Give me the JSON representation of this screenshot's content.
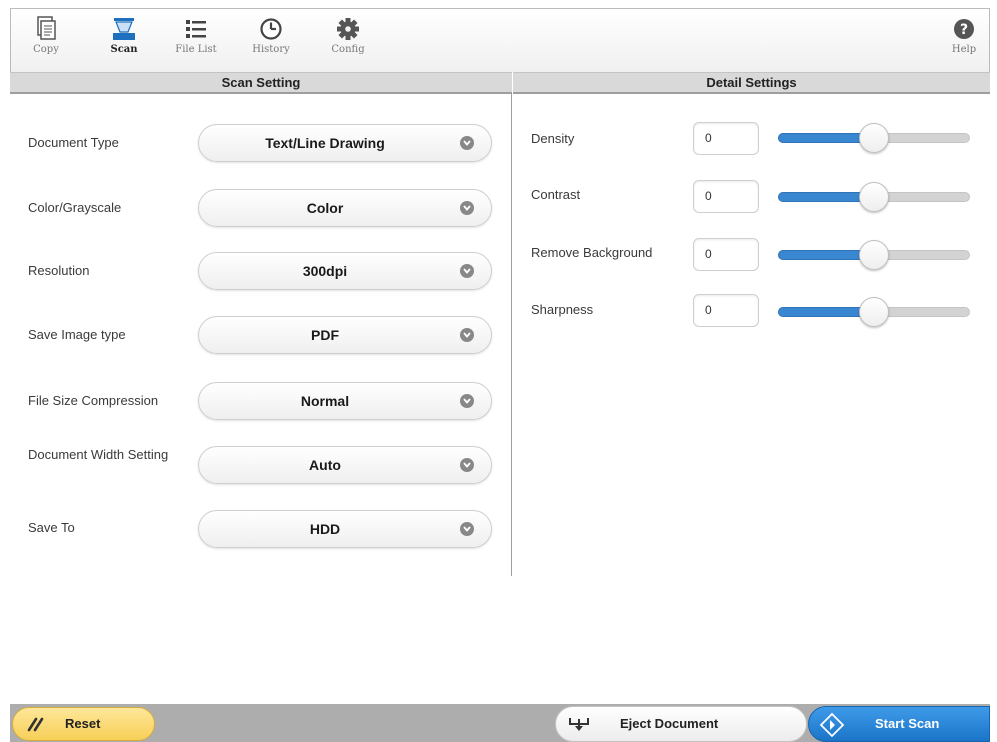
{
  "toolbar": {
    "copy": {
      "label": "Copy",
      "icon": "copy-icon"
    },
    "scan": {
      "label": "Scan",
      "icon": "scan-icon",
      "active": true
    },
    "file_list": {
      "label": "File List",
      "icon": "list-icon"
    },
    "history": {
      "label": "History",
      "icon": "clock-icon"
    },
    "config": {
      "label": "Config",
      "icon": "gear-icon"
    },
    "help": {
      "label": "Help",
      "icon": "help-icon"
    }
  },
  "scan_setting": {
    "title": "Scan Setting",
    "rows": [
      {
        "label": "Document Type",
        "value": "Text/Line Drawing"
      },
      {
        "label": "Color/Grayscale",
        "value": "Color"
      },
      {
        "label": "Resolution",
        "value": "300dpi"
      },
      {
        "label": "Save Image type",
        "value": "PDF"
      },
      {
        "label": "File Size Compression",
        "value": "Normal"
      },
      {
        "label": "Document Width Setting",
        "value": "Auto"
      },
      {
        "label": "Save To",
        "value": "HDD"
      }
    ]
  },
  "detail_settings": {
    "title": "Detail Settings",
    "rows": [
      {
        "label": "Density",
        "value": "0",
        "slider_fraction": 0.5
      },
      {
        "label": "Contrast",
        "value": "0",
        "slider_fraction": 0.5
      },
      {
        "label": "Remove Background",
        "value": "0",
        "slider_fraction": 0.5
      },
      {
        "label": "Sharpness",
        "value": "0",
        "slider_fraction": 0.5
      }
    ]
  },
  "bottom": {
    "reset_label": "Reset",
    "eject_label": "Eject Document",
    "start_label": "Start Scan"
  },
  "colors": {
    "accent": "#1b74c7",
    "slider_fill": "#3a87d1",
    "reset_button": "#f7cf57"
  }
}
